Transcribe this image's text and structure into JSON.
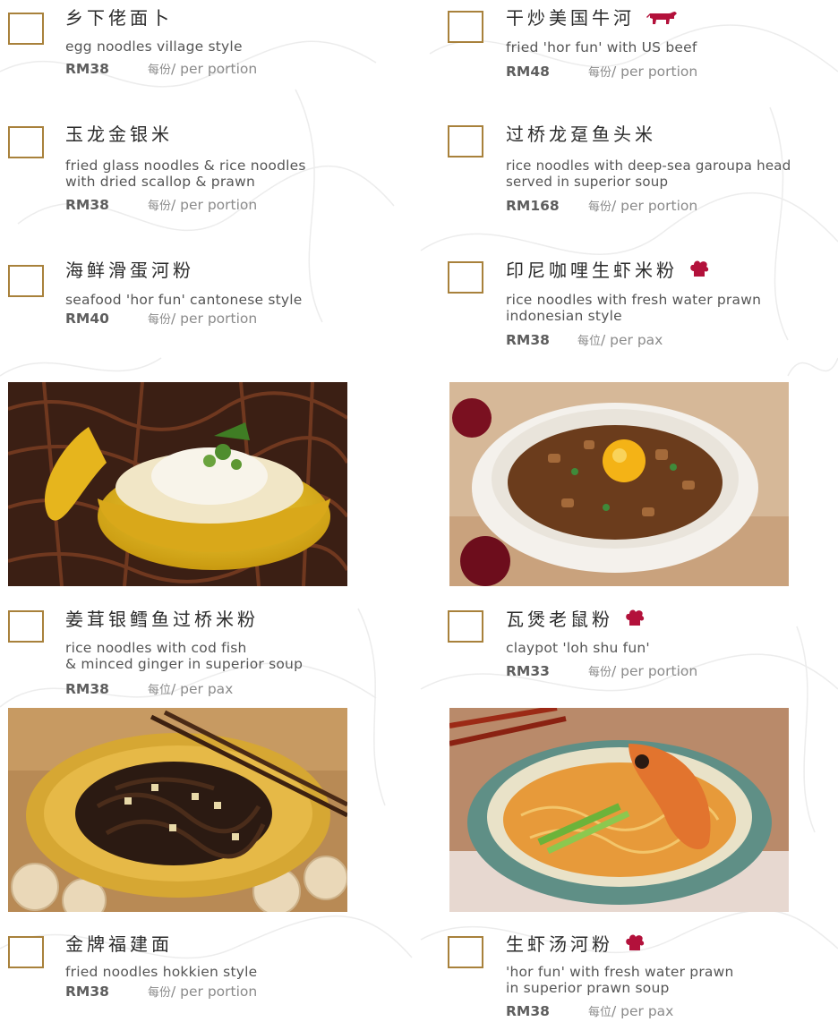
{
  "colors": {
    "accent": "#a8813b",
    "badge": "#b3113b"
  },
  "items": [
    {
      "cn": "乡下佬面卜",
      "en": "egg noodles village style",
      "price": "RM38",
      "unit_cn": "每份",
      "unit_en": "/ per portion"
    },
    {
      "cn": "干炒美国牛河",
      "en": "fried 'hor fun' with US beef",
      "price": "RM48",
      "unit_cn": "每份",
      "unit_en": "/ per portion",
      "icon": "cow-icon"
    },
    {
      "cn": "玉龙金银米",
      "en": "fried glass noodles & rice noodles\nwith dried scallop & prawn",
      "price": "RM38",
      "unit_cn": "每份",
      "unit_en": "/ per portion"
    },
    {
      "cn": "过桥龙趸鱼头米",
      "en": "rice noodles with deep-sea garoupa head\nserved in superior soup",
      "price": "RM168",
      "unit_cn": "每份",
      "unit_en": "/ per portion"
    },
    {
      "cn": "海鲜滑蛋河粉",
      "en": "seafood 'hor fun' cantonese style",
      "price": "RM40",
      "unit_cn": "每份",
      "unit_en": "/ per portion"
    },
    {
      "cn": "印尼咖哩生虾米粉",
      "en": "rice noodles with fresh water prawn\nindonesian style",
      "price": "RM38",
      "unit_cn": "每位",
      "unit_en": "/ per pax",
      "icon": "chef-hat-icon"
    },
    {
      "cn": "姜茸银鳕鱼过桥米粉",
      "en": "rice noodles with cod fish\n& minced ginger in superior soup",
      "price": "RM38",
      "unit_cn": "每位",
      "unit_en": "/ per pax"
    },
    {
      "cn": "瓦煲老鼠粉",
      "en": "claypot 'loh shu fun'",
      "price": "RM33",
      "unit_cn": "每份",
      "unit_en": "/ per portion",
      "icon": "chef-hat-icon"
    },
    {
      "cn": "金牌福建面",
      "en": "fried noodles hokkien style",
      "price": "RM38",
      "unit_cn": "每份",
      "unit_en": "/ per portion"
    },
    {
      "cn": "生虾汤河粉",
      "en": "'hor fun' with fresh water prawn\nin superior prawn soup",
      "price": "RM38",
      "unit_cn": "每位",
      "unit_en": "/ per pax",
      "icon": "chef-hat-icon"
    }
  ]
}
